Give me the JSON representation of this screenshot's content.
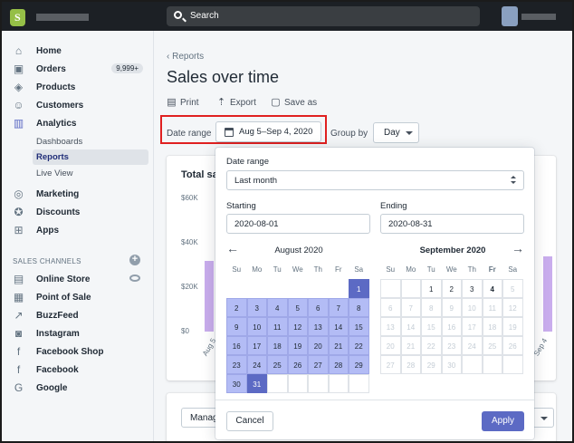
{
  "topbar": {
    "search_placeholder": "Search"
  },
  "sidebar": {
    "items": [
      {
        "label": "Home",
        "icon": "home-icon"
      },
      {
        "label": "Orders",
        "icon": "orders-icon",
        "badge": "9,999+"
      },
      {
        "label": "Products",
        "icon": "tag-icon"
      },
      {
        "label": "Customers",
        "icon": "person-icon"
      },
      {
        "label": "Analytics",
        "icon": "bar-chart-icon"
      }
    ],
    "analytics_sub": [
      "Dashboards",
      "Reports",
      "Live View"
    ],
    "items2": [
      {
        "label": "Marketing",
        "icon": "target-icon"
      },
      {
        "label": "Discounts",
        "icon": "discount-icon"
      },
      {
        "label": "Apps",
        "icon": "apps-icon"
      }
    ],
    "channels_title": "SALES CHANNELS",
    "channels": [
      {
        "label": "Online Store",
        "icon": "store-icon"
      },
      {
        "label": "Point of Sale",
        "icon": "pos-icon"
      },
      {
        "label": "BuzzFeed",
        "icon": "buzzfeed-icon"
      },
      {
        "label": "Instagram",
        "icon": "instagram-icon"
      },
      {
        "label": "Facebook Shop",
        "icon": "facebook-icon"
      },
      {
        "label": "Facebook",
        "icon": "facebook-icon"
      },
      {
        "label": "Google",
        "icon": "google-icon"
      }
    ]
  },
  "main": {
    "breadcrumb": "Reports",
    "title": "Sales over time",
    "actions": [
      "Print",
      "Export",
      "Save as"
    ],
    "date_range_label": "Date range",
    "date_range_value": "Aug 5–Sep 4, 2020",
    "group_by_label": "Group by",
    "group_by_value": "Day",
    "card_title": "Total sa",
    "y_ticks": [
      "$60K",
      "$40K",
      "$20K",
      "$0"
    ],
    "x_first": "Aug 5",
    "x_last": "Sep 4",
    "manage_label": "Manag"
  },
  "chart_data": {
    "type": "bar",
    "categories": [
      "Aug 5",
      "Sep 4"
    ],
    "values": [
      32000,
      34000
    ],
    "ylim": [
      0,
      60000
    ],
    "title": "",
    "xlabel": "",
    "ylabel": ""
  },
  "popover": {
    "range_label": "Date range",
    "range_value": "Last month",
    "starting_label": "Starting",
    "starting_value": "2020-08-01",
    "ending_label": "Ending",
    "ending_value": "2020-08-31",
    "weekdays": [
      "Su",
      "Mo",
      "Tu",
      "We",
      "Th",
      "Fr",
      "Sa"
    ],
    "left_month": {
      "title": "August 2020",
      "start_offset": 6,
      "days": 31
    },
    "right_month": {
      "title": "September 2020",
      "start_offset": 2,
      "days": 30,
      "today": 4
    },
    "cancel_label": "Cancel",
    "apply_label": "Apply"
  },
  "colors": {
    "accent": "#5c6ac4",
    "range": "#b3bcf5",
    "bars": "#9c6ade",
    "highlight": "#e02020"
  }
}
